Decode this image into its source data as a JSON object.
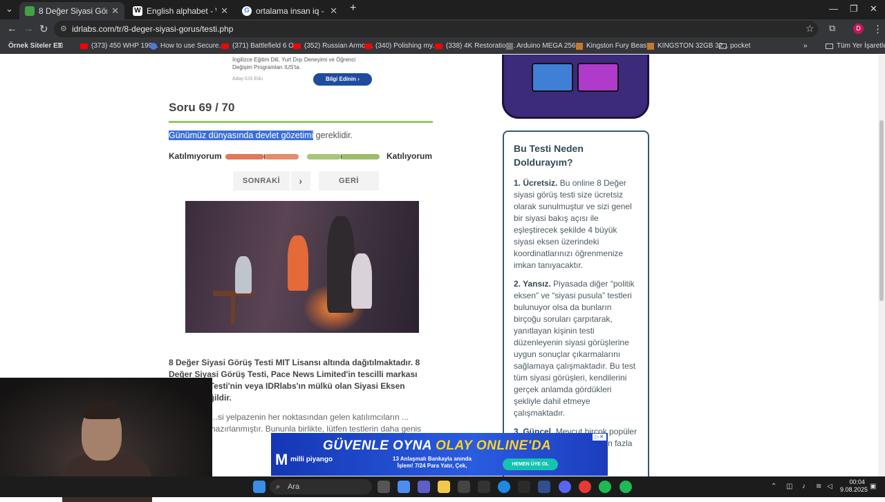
{
  "tabs": [
    {
      "label": "8 Değer Siyasi Görüş Testi",
      "active": true
    },
    {
      "label": "English alphabet - Wikipedia",
      "active": false
    },
    {
      "label": "ortalama insan iq - Google'da Ara",
      "active": false
    }
  ],
  "address": {
    "url": "idrlabs.com/tr/8-deger-siyasi-gorus/testi.php"
  },
  "bookmarks": [
    "Örnek Siteler ET",
    "(373) 450 WHP 199...",
    "How to use Secure...",
    "(371) Battlefield 6 O...",
    "(352) Russian Armor...",
    "(340) Polishing my...",
    "(338) 4K Restoration...",
    "Arduino MEGA 256...",
    "Kingston Fury Beast...",
    "KINGSTON 32GB 32...",
    "pocket",
    "Tüm Yer İşaretleri"
  ],
  "top_ad": {
    "text": "İngilizce Eğitim Dili, Yurt Dışı Deneyimi ve Öğrenci Değişim Programları IUS'ta.",
    "source": "Aday IUS Edu",
    "button": "Bilgi Edinin"
  },
  "quiz": {
    "counter": "Soru 69 / 70",
    "question_highlight": "Günümüz dünyasında devlet gözetimi",
    "question_rest": " gereklidir.",
    "disagree": "Katılmıyorum",
    "agree": "Katılıyorum",
    "next": "SONRAKİ",
    "back": "GERİ"
  },
  "info": {
    "bold": "8 Değer Siyasi Görüş Testi MIT Lisansı altında dağıtılmaktadır. 8 Değer Siyasi Görüş Testi, Pace News Limited'in tescilli markası olan ...ula Testi'nin veya IDRlabs'ın mülkü olan Siyasi Eksen ...uadili değildir.",
    "normal": "...si yelpazenin her noktasından gelen katılımcıların ... hazırlanmıştır. Bununla birlikte, lütfen testlerin daha genis"
  },
  "why": {
    "title": "Bu Testi Neden Doldurayım?",
    "points": [
      {
        "lead": "1. Ücretsiz.",
        "text": " Bu online 8 Değer siyasi görüş testi size ücretsiz olarak sunulmuştur ve sizi genel bir siyasi bakış açısı ile eşleştirecek şekilde 4 büyük siyasi eksen üzerindeki koordinatlarınızı öğrenmenize imkan tanıyacaktır."
      },
      {
        "lead": "2. Yansız.",
        "text": " Piyasada diğer “politik eksen” ve “siyasi pusula” testleri bulunuyor olsa da bunların birçoğu soruları çarpıtarak, yanıtlayan kişinin testi düzenleyenin siyasi görüşlerine uygun sonuçlar çıkarmalarını sağlamaya çalışmaktadır. Bu test tüm siyasi görüşleri, kendilerini gerçek anlamda gördükleri şekliyle dahil etmeye çalışmaktadır."
      },
      {
        "lead": "3. Güncel.",
        "text": " Mevcut birçok popüler siyasi eksen testi 10 yıldan fazla"
      }
    ]
  },
  "bottom_ad": {
    "headline_white": "GÜVENLE OYNA ",
    "headline_accent": "OLAY ONLINE'DA",
    "sub": "13 Anlaşmalı Bankayla anında İşlem! 7/24 Para Yatır, Çek,",
    "cta": "HEMEN ÜYE OL",
    "logo": "milli piyango"
  },
  "taskbar": {
    "search": "Ara",
    "time": "00:04",
    "date": "9.08.2025"
  }
}
